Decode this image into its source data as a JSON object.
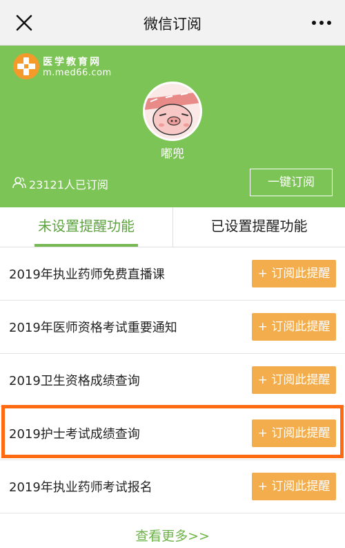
{
  "nav": {
    "title": "微信订阅",
    "close_icon": "close-icon",
    "more_icon": "more-dots-icon"
  },
  "hero": {
    "logo_name": "医学教育网",
    "logo_url": "m.med66.com",
    "username": "嘟兜",
    "sub_count": "23121人已订阅",
    "onekey_label": "一键订阅",
    "background_color": "#7dc457"
  },
  "tabs": [
    {
      "label": "未设置提醒功能",
      "active": true
    },
    {
      "label": "已设置提醒功能",
      "active": false
    }
  ],
  "items": [
    {
      "title": "2019年执业药师免费直播课",
      "button": "+ 订阅此提醒"
    },
    {
      "title": "2019年医师资格考试重要通知",
      "button": "+ 订阅此提醒"
    },
    {
      "title": "2019卫生资格成绩查询",
      "button": "+ 订阅此提醒"
    },
    {
      "title": "2019护士考试成绩查询",
      "button": "+ 订阅此提醒",
      "highlighted": true
    },
    {
      "title": "2019年执业药师考试报名",
      "button": "+ 订阅此提醒"
    }
  ],
  "footer": {
    "more_label": "查看更多>>"
  },
  "colors": {
    "accent_green": "#76b852",
    "button_orange": "#f4ad4c",
    "highlight_orange": "#ff6a13"
  }
}
